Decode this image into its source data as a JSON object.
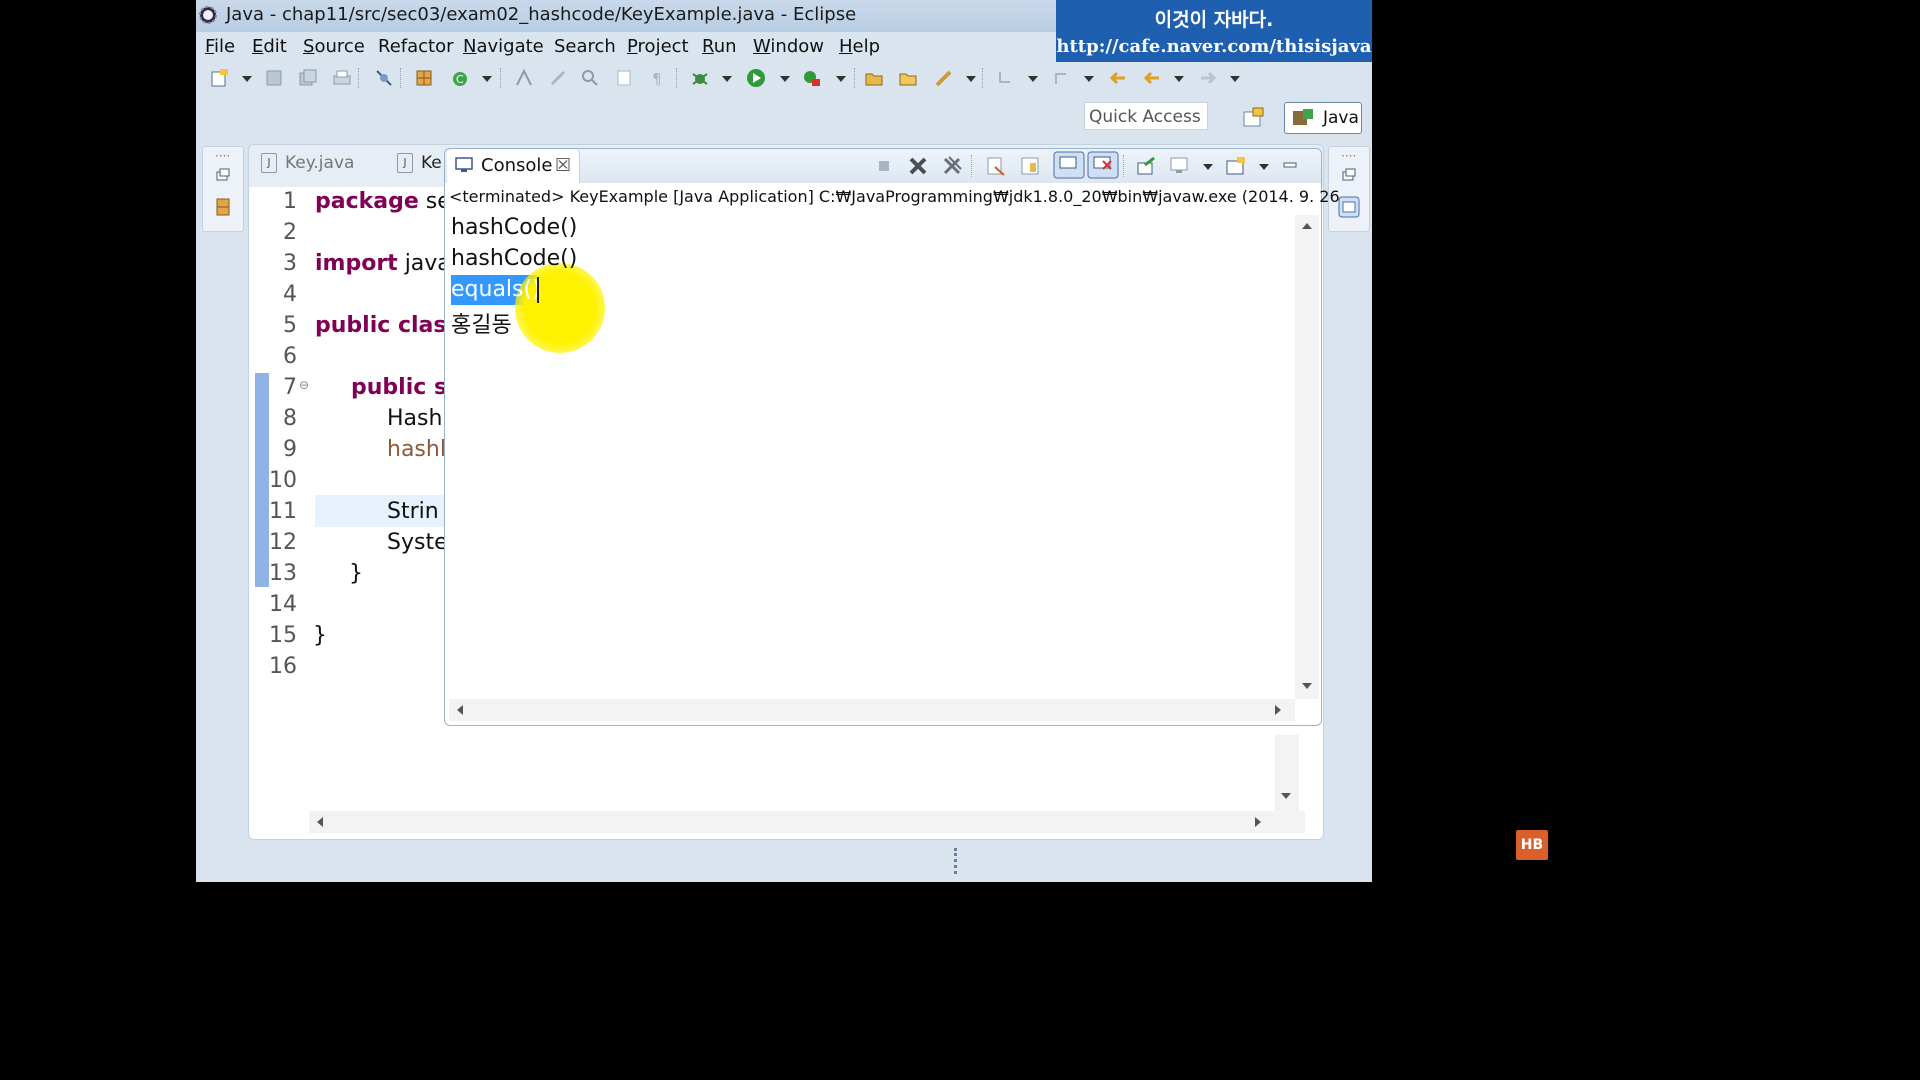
{
  "window": {
    "title": "Java - chap11/src/sec03/exam02_hashcode/KeyExample.java - Eclipse",
    "title_icon": "eclipse-icon"
  },
  "banner": {
    "korean": "이것이 자바다.",
    "url": "http://cafe.naver.com/thisisjava"
  },
  "menu": [
    {
      "label": "File",
      "u": "F",
      "rest": "ile"
    },
    {
      "label": "Edit",
      "u": "E",
      "rest": "dit"
    },
    {
      "label": "Source",
      "u": "S",
      "rest": "ource"
    },
    {
      "label": "Refactor",
      "u": "",
      "rest": "Refactor"
    },
    {
      "label": "Navigate",
      "u": "N",
      "rest": "avigate"
    },
    {
      "label": "Search",
      "u": "",
      "rest": "Search"
    },
    {
      "label": "Project",
      "u": "P",
      "rest": "roject"
    },
    {
      "label": "Run",
      "u": "R",
      "rest": "un"
    },
    {
      "label": "Window",
      "u": "W",
      "rest": "indow"
    },
    {
      "label": "Help",
      "u": "H",
      "rest": "elp"
    }
  ],
  "quick_access": {
    "placeholder": "Quick Access"
  },
  "perspective": {
    "label": "Java"
  },
  "editor": {
    "tabs": [
      {
        "label": "Key.java"
      },
      {
        "label": "Ke"
      }
    ],
    "line_numbers": [
      "1",
      "2",
      "3",
      "4",
      "5",
      "6",
      "7",
      "8",
      "9",
      "10",
      "11",
      "12",
      "13",
      "14",
      "15",
      "16"
    ],
    "lines": {
      "l1_kw": "package",
      "l1_rest": " se",
      "l3_kw": "import",
      "l3_rest": " java",
      "l5_kw": "public",
      "l5_kw2": " clas",
      "l7_kw": "public",
      "l7_rest": " s",
      "l8": "Hash",
      "l9": "hashl",
      "l11": "Strin",
      "l12": "Syste",
      "l13": "}",
      "l15": "}"
    }
  },
  "console": {
    "tab_label": "Console",
    "status": "<terminated> KeyExample [Java Application] C:₩JavaProgramming₩jdk1.8.0_20₩bin₩javaw.exe (2014. 9. 26",
    "output": [
      "hashCode()",
      "hashCode()",
      "equals()",
      "홍길동"
    ],
    "selected_line_index": 2
  },
  "colors": {
    "keyword": "#7f0055",
    "selection": "#3399ff",
    "banner": "#1e5fb0",
    "pointer_highlight": "#fff200"
  }
}
